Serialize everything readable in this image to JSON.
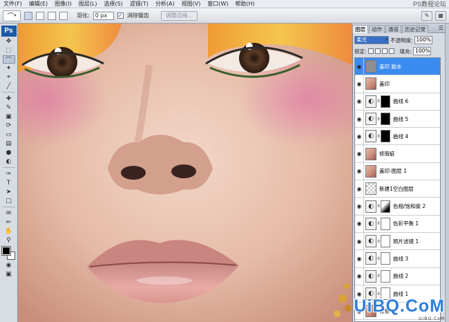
{
  "menubar": {
    "items": [
      "文件(F)",
      "编辑(E)",
      "图像(I)",
      "图层(L)",
      "选择(S)",
      "滤镜(T)",
      "分析(A)",
      "视图(V)",
      "窗口(W)",
      "帮助(H)"
    ],
    "watermark": "PS教程论坛"
  },
  "options": {
    "tool_icon": "lasso-icon",
    "feather_label": "羽化:",
    "feather_value": "0 px",
    "antialias_label": "消除锯齿",
    "antialias_checked": true,
    "refine_edge_label": "调整边缘..."
  },
  "panel": {
    "tabs": [
      "图层",
      "动作",
      "通道",
      "历史记录"
    ],
    "active_tab": 0,
    "blend_mode": "柔光",
    "opacity_label": "不透明度:",
    "opacity_value": "100%",
    "lock_label": "锁定:",
    "fill_label": "填充:",
    "fill_value": "100%"
  },
  "layers": [
    {
      "name": "盖印 副本",
      "thumb": "gray",
      "selected": true
    },
    {
      "name": "盖印",
      "thumb": "face"
    },
    {
      "name": "曲线 6",
      "thumb": "adj",
      "mask": "black"
    },
    {
      "name": "曲线 5",
      "thumb": "adj",
      "mask": "black"
    },
    {
      "name": "曲线 4",
      "thumb": "adj",
      "mask": "black"
    },
    {
      "name": "修瑕疵",
      "thumb": "face"
    },
    {
      "name": "盖印-图层 1",
      "thumb": "face"
    },
    {
      "name": "新建1空白图层",
      "thumb": "checker"
    },
    {
      "name": "色相/饱和度 2",
      "thumb": "adj",
      "mask": "grad"
    },
    {
      "name": "色彩平衡 1",
      "thumb": "adj",
      "mask": "white"
    },
    {
      "name": "照片滤镜 1",
      "thumb": "adj",
      "mask": "white"
    },
    {
      "name": "曲线 3",
      "thumb": "adj",
      "mask": "white"
    },
    {
      "name": "曲线 2",
      "thumb": "adj",
      "mask": "white"
    },
    {
      "name": "曲线 1",
      "thumb": "adj",
      "mask": "white"
    },
    {
      "name": "背景",
      "thumb": "face"
    }
  ],
  "watermark": {
    "logo": "UiBQ.CoM",
    "sub": "UiBQ.CoM"
  }
}
